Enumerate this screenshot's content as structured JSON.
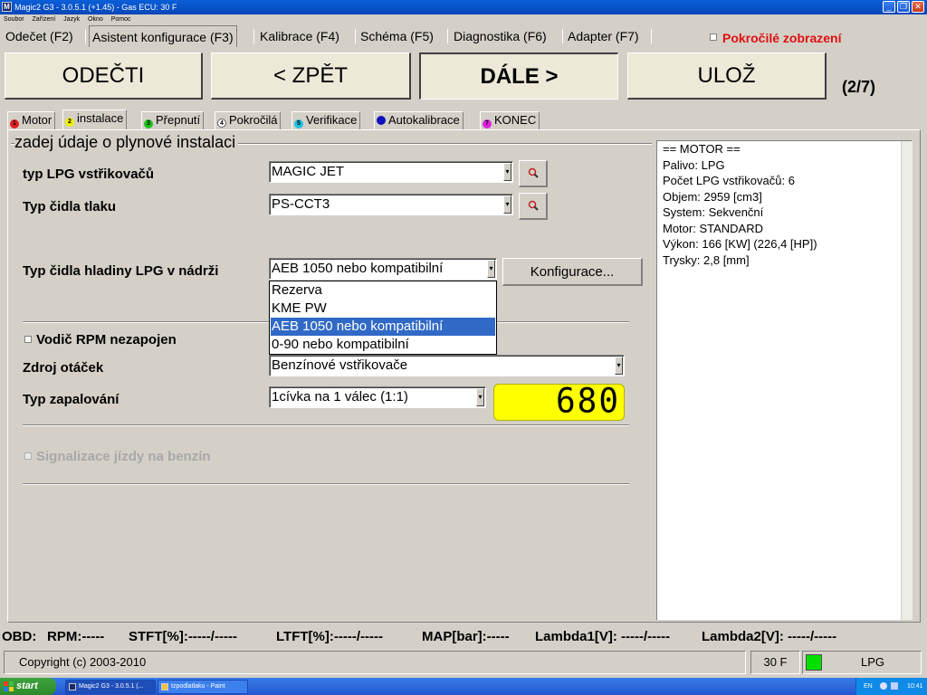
{
  "window": {
    "title": "Magic2 G3 - 3.0.5.1 (+1.45) - Gas ECU: 30 F",
    "app_icon": "M",
    "minimize_icon": "_",
    "restore_icon": "❐",
    "close_icon": "✕"
  },
  "menu": [
    "Soubor",
    "Zařízení",
    "Jazyk",
    "Okno",
    "Pomoc"
  ],
  "top_tabs": [
    "Odečet (F2)",
    "Asistent konfigurace (F3)",
    "Kalibrace (F4)",
    "Schéma (F5)",
    "Diagnostika (F6)",
    "Adapter (F7)"
  ],
  "advanced_view_label": "Pokročilé zobrazení",
  "buttons": {
    "read": "ODEČTI",
    "back": "< ZPĚT",
    "next": "DÁLE >",
    "save": "ULOŽ",
    "configure": "Konfigurace..."
  },
  "step_counter": "(2/7)",
  "wizard_tabs": [
    {
      "num": "1",
      "label": "Motor",
      "color": "#e02020"
    },
    {
      "num": "2",
      "label": "instalace",
      "color": "#f0f000"
    },
    {
      "num": "3",
      "label": "Přepnutí",
      "color": "#20c020"
    },
    {
      "num": "4",
      "label": "Pokročilá",
      "color": "#ffffff"
    },
    {
      "num": "5",
      "label": "Verifikace",
      "color": "#20c0e0"
    },
    {
      "num": "6",
      "label": "Autokalibrace",
      "color": "#1010c0"
    },
    {
      "num": "7",
      "label": "KONEC",
      "color": "#e020e0"
    }
  ],
  "group_title": "zadej údaje o plynové instalaci",
  "fields": {
    "injector_type_label": "typ LPG vstřikovačů",
    "injector_type_value": "MAGIC JET",
    "pressure_sensor_label": "Typ čidla tlaku",
    "pressure_sensor_value": "PS-CCT3",
    "level_sensor_label": "Typ čidla hladiny LPG v nádrži",
    "level_sensor_value": "AEB 1050 nebo kompatibilní",
    "rpm_wire_label": "Vodič RPM nezapojen",
    "rpm_source_label": "Zdroj otáček",
    "rpm_source_value": "Benzínové vstřikovače",
    "ignition_label": "Typ zapalování",
    "ignition_value": "1cívka na 1 válec (1:1)",
    "rpm_display": "680",
    "petrol_signal_label": "Signalizace jízdy na benzín"
  },
  "level_sensor_options": [
    "Rezerva",
    "KME PW",
    "AEB 1050 nebo kompatibilní",
    "0-90 nebo kompatibilní"
  ],
  "level_sensor_highlighted": "AEB 1050 nebo kompatibilní",
  "info_lines": [
    "== MOTOR ==",
    "Palivo: LPG",
    "Počet LPG vstřikovačů: 6",
    "Objem: 2959 [cm3]",
    "System: Sekvenční",
    "Motor: STANDARD",
    "Výkon: 166 [KW] (226,4 [HP])",
    "Trysky: 2,8 [mm]"
  ],
  "obd": {
    "prefix": "OBD:",
    "rpm": "RPM:-----",
    "stft": "STFT[%]:-----/-----",
    "ltft": "LTFT[%]:-----/-----",
    "map": "MAP[bar]:-----",
    "lambda1": "Lambda1[V]: -----/-----",
    "lambda2": "Lambda2[V]: -----/-----"
  },
  "status": {
    "copyright": "Copyright (c) 2003-2010",
    "ecu": "30 F",
    "fuel": "LPG",
    "fuel_led_color": "#00e000"
  },
  "taskbar": {
    "start": "start",
    "tasks": [
      "Magic2 G3 - 3.0.5.1 (...",
      "tzpodlatlaku - Paint"
    ],
    "lang": "EN",
    "clock": "10:41"
  }
}
